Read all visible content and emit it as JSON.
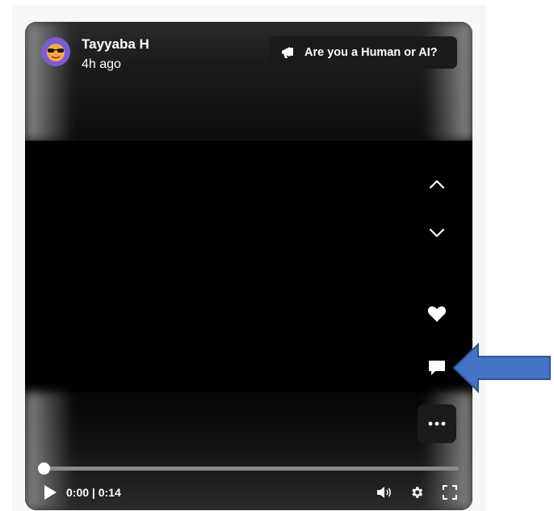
{
  "post": {
    "username": "Tayyaba H",
    "timestamp": "4h ago",
    "ai_button_label": "Are you a Human or AI?"
  },
  "player": {
    "current_time": "0:00",
    "separator": "|",
    "duration": "0:14",
    "progress_fraction": 0
  },
  "icons": {
    "avatar": "avatar-emoji-sunglasses",
    "ai_button": "megaphone-icon",
    "nav_up": "chevron-up-icon",
    "nav_down": "chevron-down-icon",
    "like": "heart-icon",
    "comment": "comment-icon",
    "more": "more-icon",
    "play": "play-icon",
    "volume": "volume-icon",
    "settings": "gear-icon",
    "fullscreen": "fullscreen-icon",
    "annotation": "arrow-left-annotation"
  },
  "colors": {
    "card_bg": "#000000",
    "annotation_arrow": "#4472C4",
    "annotation_border": "#2F5597",
    "avatar_bg": "#7b5bd6"
  }
}
